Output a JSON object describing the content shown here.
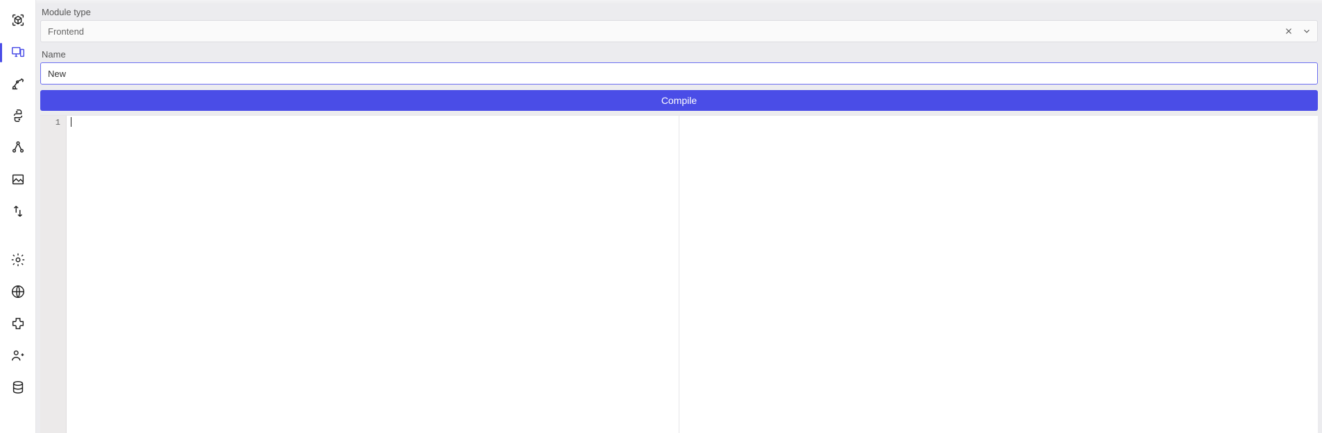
{
  "colors": {
    "accent": "#4a4de7"
  },
  "sidebar": {
    "items": [
      {
        "name": "cube-icon",
        "active": false
      },
      {
        "name": "devices-icon",
        "active": true
      },
      {
        "name": "robot-arm-icon",
        "active": false
      },
      {
        "name": "python-icon",
        "active": false
      },
      {
        "name": "nodes-icon",
        "active": false
      },
      {
        "name": "image-edit-icon",
        "active": false
      },
      {
        "name": "transfer-icon",
        "active": false
      },
      {
        "name": "settings-icon",
        "active": false
      },
      {
        "name": "globe-icon",
        "active": false
      },
      {
        "name": "extension-icon",
        "active": false
      },
      {
        "name": "users-icon",
        "active": false
      },
      {
        "name": "database-icon",
        "active": false
      }
    ]
  },
  "form": {
    "module_type_label": "Module type",
    "module_type_value": "Frontend",
    "name_label": "Name",
    "name_value": "New",
    "compile_label": "Compile"
  },
  "editor": {
    "line_numbers": [
      "1"
    ],
    "content": ""
  }
}
